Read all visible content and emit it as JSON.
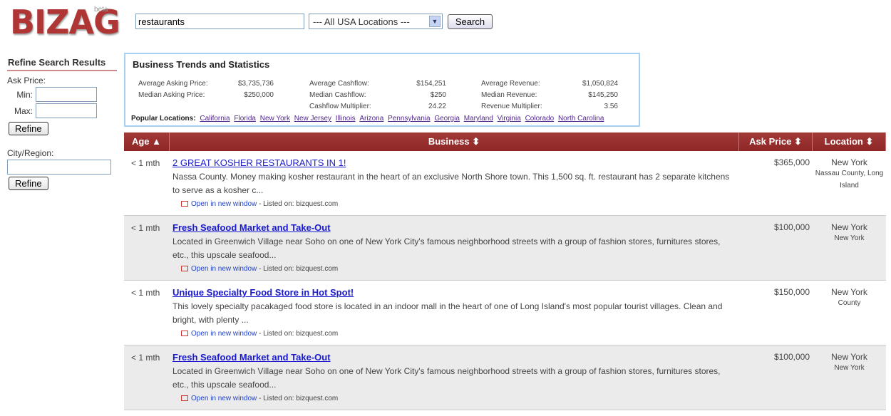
{
  "logo": {
    "text": "BIZAG",
    "beta": "beta"
  },
  "search": {
    "query": "restaurants",
    "location": "--- All USA Locations ---",
    "button": "Search"
  },
  "sidebar": {
    "title": "Refine Search Results",
    "ask_price": "Ask Price:",
    "min": "Min:",
    "max": "Max:",
    "refine": "Refine",
    "city": "City/Region:"
  },
  "stats": {
    "title": "Business Trends and Statistics",
    "col1": [
      [
        "Average Asking Price:",
        "$3,735,736"
      ],
      [
        "Median Asking Price:",
        "$250,000"
      ]
    ],
    "col2": [
      [
        "Average Cashflow:",
        "$154,251"
      ],
      [
        "Median Cashflow:",
        "$250"
      ],
      [
        "Cashflow Multiplier:",
        "24.22"
      ]
    ],
    "col3": [
      [
        "Average Revenue:",
        "$1,050,824"
      ],
      [
        "Median Revenue:",
        "$145,250"
      ],
      [
        "Revenue Multiplier:",
        "3.56"
      ]
    ],
    "popular_label": "Popular Locations:",
    "popular": [
      "California",
      "Florida",
      "New York",
      "New Jersey",
      "Illinois",
      "Arizona",
      "Pennsylvania",
      "Georgia",
      "Maryland",
      "Virginia",
      "Colorado",
      "North Carolina"
    ]
  },
  "table": {
    "headers": [
      "Age ▲",
      "Business ⬍",
      "Ask Price ⬍",
      "Location ⬍"
    ],
    "open_label": "Open in new window",
    "listed_label": "- Listed on: bizquest.com",
    "rows": [
      {
        "age": "< 1 mth",
        "title": "2 GREAT KOSHER RESTAURANTS IN 1!",
        "desc": "Nassa County. Money making kosher restaurant in the heart of an exclusive North Shore town. This 1,500 sq. ft. restaurant has 2 separate kitchens to serve as a kosher c...",
        "price": "$365,000",
        "state": "New York",
        "region": "Nassau County, Long Island"
      },
      {
        "age": "< 1 mth",
        "title": "Fresh Seafood Market and Take-Out",
        "desc": "Located in Greenwich Village near Soho on one of New York City's famous neighborhood streets with a group of fashion stores, furnitures stores, etc., this upscale seafood...",
        "price": "$100,000",
        "state": "New York",
        "region": "New York"
      },
      {
        "age": "< 1 mth",
        "title": "Unique Specialty Food Store in Hot Spot!",
        "desc": "This lovely specialty pacakaged food store is located in an indoor mall in the heart of one of Long Island's most popular tourist villages. Clean and bright, with plenty ...",
        "price": "$150,000",
        "state": "New York",
        "region": "County"
      },
      {
        "age": "< 1 mth",
        "title": "Fresh Seafood Market and Take-Out",
        "desc": "Located in Greenwich Village near Soho on one of New York City's famous neighborhood streets with a group of fashion stores, furnitures stores, etc., this upscale seafood...",
        "price": "$100,000",
        "state": "New York",
        "region": "New York"
      }
    ]
  }
}
